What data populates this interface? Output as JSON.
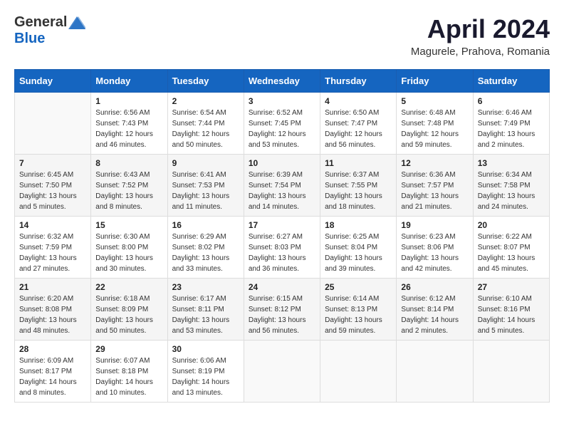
{
  "header": {
    "logo_general": "General",
    "logo_blue": "Blue",
    "month_title": "April 2024",
    "subtitle": "Magurele, Prahova, Romania"
  },
  "days_of_week": [
    "Sunday",
    "Monday",
    "Tuesday",
    "Wednesday",
    "Thursday",
    "Friday",
    "Saturday"
  ],
  "weeks": [
    [
      {
        "day": "",
        "info": ""
      },
      {
        "day": "1",
        "info": "Sunrise: 6:56 AM\nSunset: 7:43 PM\nDaylight: 12 hours\nand 46 minutes."
      },
      {
        "day": "2",
        "info": "Sunrise: 6:54 AM\nSunset: 7:44 PM\nDaylight: 12 hours\nand 50 minutes."
      },
      {
        "day": "3",
        "info": "Sunrise: 6:52 AM\nSunset: 7:45 PM\nDaylight: 12 hours\nand 53 minutes."
      },
      {
        "day": "4",
        "info": "Sunrise: 6:50 AM\nSunset: 7:47 PM\nDaylight: 12 hours\nand 56 minutes."
      },
      {
        "day": "5",
        "info": "Sunrise: 6:48 AM\nSunset: 7:48 PM\nDaylight: 12 hours\nand 59 minutes."
      },
      {
        "day": "6",
        "info": "Sunrise: 6:46 AM\nSunset: 7:49 PM\nDaylight: 13 hours\nand 2 minutes."
      }
    ],
    [
      {
        "day": "7",
        "info": "Sunrise: 6:45 AM\nSunset: 7:50 PM\nDaylight: 13 hours\nand 5 minutes."
      },
      {
        "day": "8",
        "info": "Sunrise: 6:43 AM\nSunset: 7:52 PM\nDaylight: 13 hours\nand 8 minutes."
      },
      {
        "day": "9",
        "info": "Sunrise: 6:41 AM\nSunset: 7:53 PM\nDaylight: 13 hours\nand 11 minutes."
      },
      {
        "day": "10",
        "info": "Sunrise: 6:39 AM\nSunset: 7:54 PM\nDaylight: 13 hours\nand 14 minutes."
      },
      {
        "day": "11",
        "info": "Sunrise: 6:37 AM\nSunset: 7:55 PM\nDaylight: 13 hours\nand 18 minutes."
      },
      {
        "day": "12",
        "info": "Sunrise: 6:36 AM\nSunset: 7:57 PM\nDaylight: 13 hours\nand 21 minutes."
      },
      {
        "day": "13",
        "info": "Sunrise: 6:34 AM\nSunset: 7:58 PM\nDaylight: 13 hours\nand 24 minutes."
      }
    ],
    [
      {
        "day": "14",
        "info": "Sunrise: 6:32 AM\nSunset: 7:59 PM\nDaylight: 13 hours\nand 27 minutes."
      },
      {
        "day": "15",
        "info": "Sunrise: 6:30 AM\nSunset: 8:00 PM\nDaylight: 13 hours\nand 30 minutes."
      },
      {
        "day": "16",
        "info": "Sunrise: 6:29 AM\nSunset: 8:02 PM\nDaylight: 13 hours\nand 33 minutes."
      },
      {
        "day": "17",
        "info": "Sunrise: 6:27 AM\nSunset: 8:03 PM\nDaylight: 13 hours\nand 36 minutes."
      },
      {
        "day": "18",
        "info": "Sunrise: 6:25 AM\nSunset: 8:04 PM\nDaylight: 13 hours\nand 39 minutes."
      },
      {
        "day": "19",
        "info": "Sunrise: 6:23 AM\nSunset: 8:06 PM\nDaylight: 13 hours\nand 42 minutes."
      },
      {
        "day": "20",
        "info": "Sunrise: 6:22 AM\nSunset: 8:07 PM\nDaylight: 13 hours\nand 45 minutes."
      }
    ],
    [
      {
        "day": "21",
        "info": "Sunrise: 6:20 AM\nSunset: 8:08 PM\nDaylight: 13 hours\nand 48 minutes."
      },
      {
        "day": "22",
        "info": "Sunrise: 6:18 AM\nSunset: 8:09 PM\nDaylight: 13 hours\nand 50 minutes."
      },
      {
        "day": "23",
        "info": "Sunrise: 6:17 AM\nSunset: 8:11 PM\nDaylight: 13 hours\nand 53 minutes."
      },
      {
        "day": "24",
        "info": "Sunrise: 6:15 AM\nSunset: 8:12 PM\nDaylight: 13 hours\nand 56 minutes."
      },
      {
        "day": "25",
        "info": "Sunrise: 6:14 AM\nSunset: 8:13 PM\nDaylight: 13 hours\nand 59 minutes."
      },
      {
        "day": "26",
        "info": "Sunrise: 6:12 AM\nSunset: 8:14 PM\nDaylight: 14 hours\nand 2 minutes."
      },
      {
        "day": "27",
        "info": "Sunrise: 6:10 AM\nSunset: 8:16 PM\nDaylight: 14 hours\nand 5 minutes."
      }
    ],
    [
      {
        "day": "28",
        "info": "Sunrise: 6:09 AM\nSunset: 8:17 PM\nDaylight: 14 hours\nand 8 minutes."
      },
      {
        "day": "29",
        "info": "Sunrise: 6:07 AM\nSunset: 8:18 PM\nDaylight: 14 hours\nand 10 minutes."
      },
      {
        "day": "30",
        "info": "Sunrise: 6:06 AM\nSunset: 8:19 PM\nDaylight: 14 hours\nand 13 minutes."
      },
      {
        "day": "",
        "info": ""
      },
      {
        "day": "",
        "info": ""
      },
      {
        "day": "",
        "info": ""
      },
      {
        "day": "",
        "info": ""
      }
    ]
  ]
}
